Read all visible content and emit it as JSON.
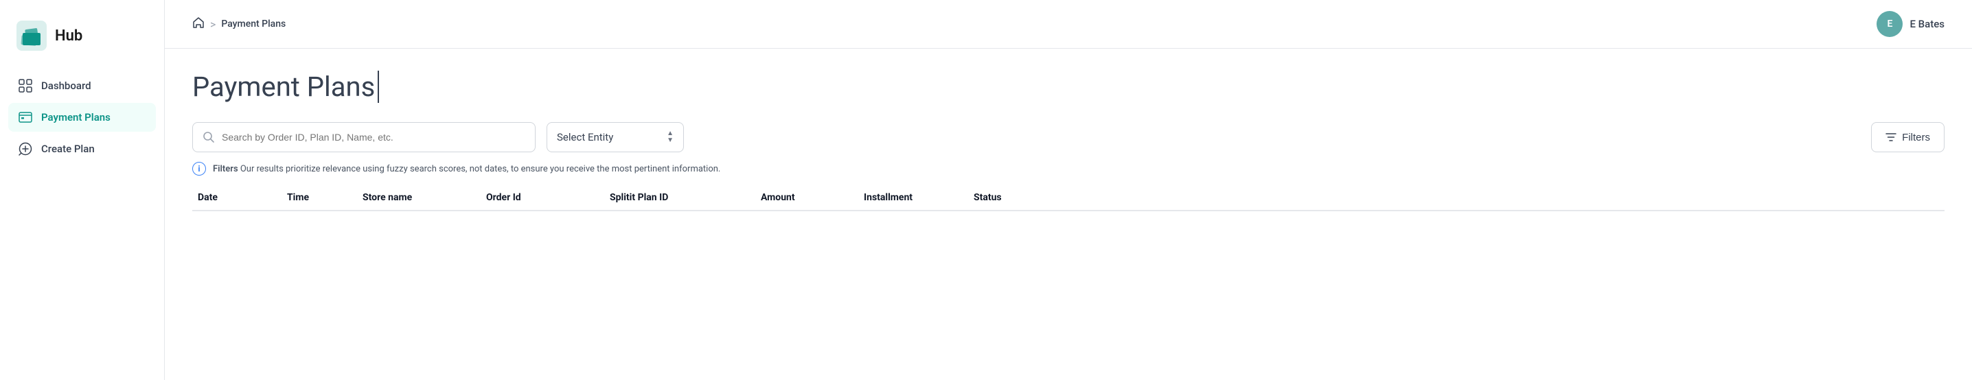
{
  "sidebar": {
    "logo_text": "Hub",
    "items": [
      {
        "id": "dashboard",
        "label": "Dashboard",
        "active": false
      },
      {
        "id": "payment-plans",
        "label": "Payment Plans",
        "active": true
      },
      {
        "id": "create-plan",
        "label": "Create Plan",
        "active": false
      }
    ]
  },
  "topbar": {
    "breadcrumb": {
      "home_aria": "home",
      "separator": ">",
      "current": "Payment Plans"
    },
    "user": {
      "initials": "E",
      "name": "E Bates"
    }
  },
  "page": {
    "title": "Payment Plans",
    "search_placeholder": "Search by Order ID, Plan ID, Name, etc.",
    "select_entity_label": "Select Entity",
    "filters_label": "Filters",
    "info_prefix": "Filters",
    "info_text": " Our results prioritize relevance using fuzzy search scores, not dates, to ensure you receive the most pertinent information."
  },
  "table": {
    "columns": [
      "Date",
      "Time",
      "Store name",
      "Order Id",
      "Splitit Plan ID",
      "Amount",
      "Installment",
      "Status"
    ]
  },
  "colors": {
    "teal": "#0d9488",
    "teal_light": "#5eaaa8",
    "blue": "#3b82f6"
  }
}
